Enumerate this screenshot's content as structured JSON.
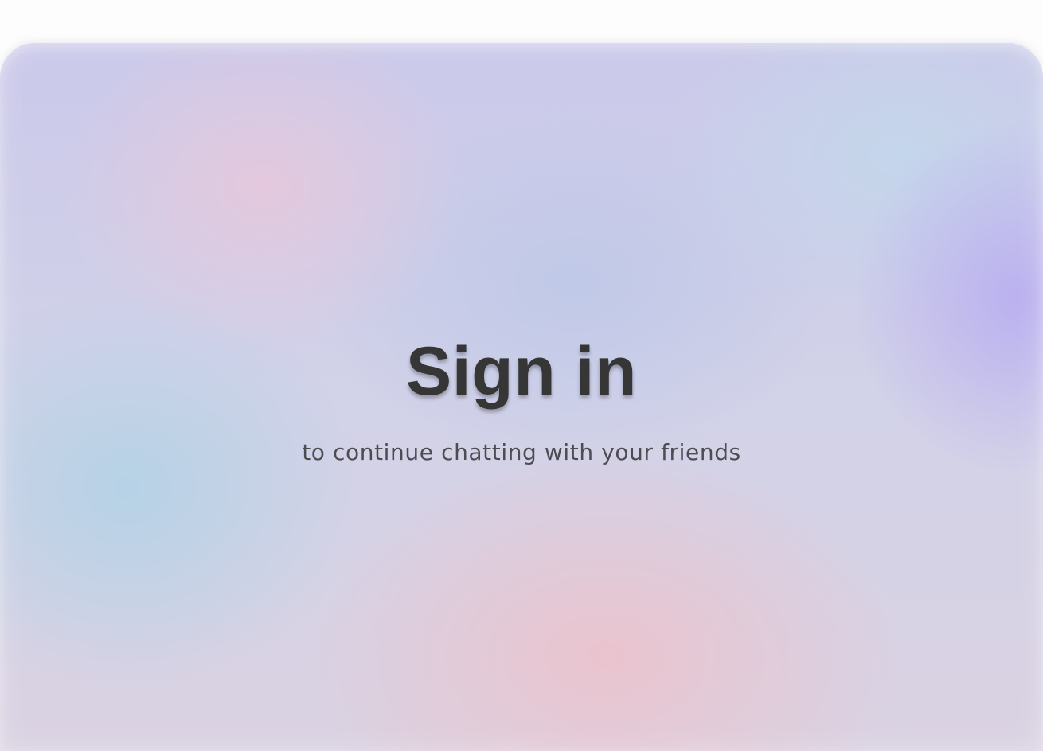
{
  "auth": {
    "title": "Sign in",
    "subtitle": "to continue chatting with your friends"
  },
  "theme": {
    "page_background": "#fdfdfd",
    "text_primary": "#363636",
    "text_secondary": "#4d4c52",
    "gradient_colors": [
      "#b4d2e6",
      "#e6c8dc",
      "#b9aff0",
      "#ebc3cd",
      "#c3d7eb",
      "#bec8e8"
    ]
  }
}
